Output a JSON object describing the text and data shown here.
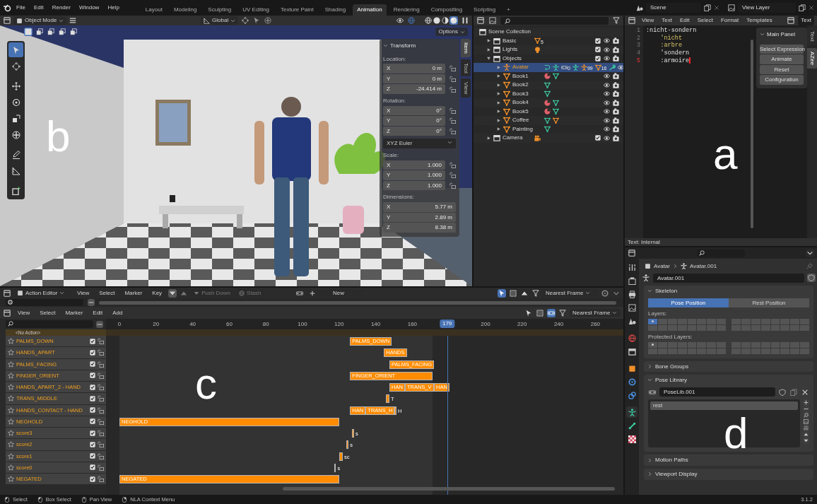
{
  "topbar": {
    "menus": [
      "File",
      "Edit",
      "Render",
      "Window",
      "Help"
    ],
    "workspaces": [
      {
        "label": "Layout",
        "selected": false
      },
      {
        "label": "Modeling",
        "selected": false
      },
      {
        "label": "Sculpting",
        "selected": false
      },
      {
        "label": "UV Editing",
        "selected": false
      },
      {
        "label": "Texture Paint",
        "selected": false
      },
      {
        "label": "Shading",
        "selected": false
      },
      {
        "label": "Animation",
        "selected": true
      },
      {
        "label": "Rendering",
        "selected": false
      },
      {
        "label": "Compositing",
        "selected": false
      },
      {
        "label": "Scripting",
        "selected": false
      }
    ],
    "add_symbol": "+",
    "scene": "Scene",
    "view_layer": "View Layer"
  },
  "viewport": {
    "mode": "Object Mode",
    "orientation": "Global",
    "options": "Options",
    "shading": [
      {
        "kind": "wireframe",
        "selected": false
      },
      {
        "kind": "solid",
        "selected": false
      },
      {
        "kind": "material",
        "selected": false
      },
      {
        "kind": "rendered",
        "selected": true
      }
    ],
    "select_modes": [
      {
        "kind": "set",
        "selected": true
      },
      {
        "kind": "extend",
        "selected": false
      },
      {
        "kind": "subtract",
        "selected": false
      },
      {
        "kind": "invert",
        "selected": false
      },
      {
        "kind": "intersect",
        "selected": false
      }
    ],
    "tools": [
      {
        "kind": "select",
        "selected": true
      },
      {
        "kind": "cursor",
        "selected": false
      },
      {
        "kind": "move",
        "selected": false
      },
      {
        "kind": "rotate",
        "selected": false
      },
      {
        "kind": "scale",
        "selected": false
      },
      {
        "kind": "transform",
        "selected": false
      },
      {
        "kind": "annotate",
        "selected": false
      },
      {
        "kind": "measure",
        "selected": false
      },
      {
        "kind": "add_cube",
        "selected": false
      }
    ],
    "transform": {
      "title": "Transform",
      "sections": [
        {
          "kind": "vector",
          "label": "Location:",
          "fields": [
            {
              "axis": "X",
              "value": "0 m",
              "locked": false
            },
            {
              "axis": "Y",
              "value": "0 m",
              "locked": false
            },
            {
              "axis": "Z",
              "value": "-24.414 m",
              "locked": false
            }
          ]
        },
        {
          "kind": "vector",
          "label": "Rotation:",
          "fields": [
            {
              "axis": "X",
              "value": "0°",
              "locked": false
            },
            {
              "axis": "Y",
              "value": "0°",
              "locked": false
            },
            {
              "axis": "Z",
              "value": "0°",
              "locked": false
            }
          ]
        },
        {
          "kind": "dropdown",
          "value": "XYZ Euler"
        },
        {
          "kind": "vector",
          "label": "Scale:",
          "fields": [
            {
              "axis": "X",
              "value": "1.000",
              "locked": false
            },
            {
              "axis": "Y",
              "value": "1.000",
              "locked": false
            },
            {
              "axis": "Z",
              "value": "1.000",
              "locked": false
            }
          ]
        },
        {
          "kind": "dimensions",
          "label": "Dimensions:",
          "fields": [
            {
              "axis": "X",
              "value": "5.77 m"
            },
            {
              "axis": "Y",
              "value": "2.89 m"
            },
            {
              "axis": "Z",
              "value": "8.38 m"
            }
          ]
        }
      ]
    },
    "side_tabs": [
      {
        "label": "Item",
        "selected": true
      },
      {
        "label": "Tool",
        "selected": false
      },
      {
        "label": "View",
        "selected": false
      }
    ],
    "annotation": "b"
  },
  "outliner": {
    "root": "Scene Collection",
    "items": [
      {
        "label": "Basic",
        "kind": "collection",
        "expanded": false,
        "selected": false,
        "checked": true,
        "icons": [
          {
            "kind": "mesh",
            "badge": "5"
          }
        ]
      },
      {
        "label": "Lights",
        "kind": "collection",
        "expanded": false,
        "selected": false,
        "checked": true,
        "icons": [
          {
            "kind": "light"
          }
        ]
      },
      {
        "label": "Objects",
        "kind": "collection",
        "expanded": true,
        "selected": false,
        "checked": true,
        "children": [
          {
            "label": "Avatar",
            "kind": "armature",
            "expanded": false,
            "selected": true,
            "icons": [
              {
                "kind": "action"
              },
              {
                "kind": "pose"
              },
              {
                "kind": "poselib",
                "badge": "0"
              },
              {
                "kind": "pose"
              },
              {
                "kind": "armature",
                "badge": "99"
              },
              {
                "kind": "mesh",
                "badge": "16"
              },
              {
                "kind": "modifier"
              }
            ]
          },
          {
            "label": "Book1",
            "kind": "mesh",
            "expanded": false,
            "selected": false,
            "icons": [
              {
                "kind": "material"
              },
              {
                "kind": "mesh_data"
              }
            ]
          },
          {
            "label": "Book2",
            "kind": "mesh",
            "expanded": false,
            "selected": false,
            "icons": [
              {
                "kind": "mesh_data"
              }
            ]
          },
          {
            "label": "Book3",
            "kind": "mesh",
            "expanded": false,
            "selected": false,
            "icons": [
              {
                "kind": "mesh_data"
              }
            ]
          },
          {
            "label": "Book4",
            "kind": "mesh",
            "expanded": false,
            "selected": false,
            "icons": [
              {
                "kind": "material"
              },
              {
                "kind": "mesh_data"
              }
            ]
          },
          {
            "label": "Book5",
            "kind": "mesh",
            "expanded": false,
            "selected": false,
            "icons": [
              {
                "kind": "material"
              },
              {
                "kind": "mesh_data"
              }
            ]
          },
          {
            "label": "Coffee",
            "kind": "mesh",
            "expanded": false,
            "selected": false,
            "icons": [
              {
                "kind": "mesh_data"
              },
              {
                "kind": "mesh"
              }
            ]
          },
          {
            "label": "Painting",
            "kind": "mesh",
            "expanded": false,
            "selected": false,
            "icons": [
              {
                "kind": "mesh_data"
              }
            ]
          }
        ]
      },
      {
        "label": "Camera",
        "kind": "collection",
        "expanded": false,
        "selected": false,
        "checked": true,
        "icons": [
          {
            "kind": "camera_object"
          }
        ]
      }
    ]
  },
  "text_editor": {
    "menus": [
      "View",
      "Text",
      "Edit",
      "Select",
      "Format",
      "Templates"
    ],
    "text_name": "Text",
    "lines": [
      {
        "number": "1",
        "code": ":nicht-sondern",
        "kind": "plain",
        "current": false
      },
      {
        "number": "2",
        "code": "    'nicht",
        "kind": "symbol",
        "current": false
      },
      {
        "number": "3",
        "code": "    :arbre",
        "kind": "symbol",
        "current": false
      },
      {
        "number": "4",
        "code": "    'sondern",
        "kind": "plain",
        "current": false
      },
      {
        "number": "5",
        "code": "    :armoire",
        "kind": "plain",
        "current": true
      }
    ],
    "panel": {
      "title": "Main Panel",
      "buttons": [
        "Select Expression",
        "Animate",
        "Reset",
        "Configuration"
      ]
    },
    "side_tabs": [
      {
        "label": "Text",
        "selected": false
      },
      {
        "label": "AZee",
        "selected": true
      }
    ],
    "footer": "Text: Internal",
    "annotation": "a"
  },
  "nla": {
    "action_editor": {
      "mode": "Action Editor",
      "menus": [
        "View",
        "Select",
        "Marker",
        "Key"
      ],
      "push_down": "Push Down",
      "stash": "Stash",
      "new": "New",
      "snap": "Nearest Frame"
    },
    "header": {
      "menus": [
        "View",
        "Select",
        "Marker",
        "Edit",
        "Add"
      ],
      "snap": "Nearest Frame"
    },
    "ticks": [
      "0",
      "20",
      "40",
      "60",
      "80",
      "100",
      "120",
      "140",
      "160",
      "200",
      "220",
      "240",
      "260"
    ],
    "current_frame": "179",
    "action_row": "<No Action>",
    "tracks": [
      {
        "name": "PALMS_DOWN",
        "checked": true,
        "strips": [
          {
            "label": "PALMS_DOWN"
          }
        ]
      },
      {
        "name": "HANDS_APART",
        "checked": true,
        "strips": [
          {
            "label": "HANDS"
          }
        ]
      },
      {
        "name": "PALMS_FACING",
        "checked": true,
        "strips": [
          {
            "label": "PALMS_FACING"
          }
        ]
      },
      {
        "name": "FINGER_ORIENT",
        "checked": true,
        "strips": [
          {
            "label": "FINGER_ORIENT"
          }
        ]
      },
      {
        "name": "HANDS_APART_2 - HAND",
        "checked": true,
        "strips": [
          {
            "label": "HAN"
          },
          {
            "label": "TRANS_V"
          },
          {
            "label": "HAN"
          }
        ]
      },
      {
        "name": "TRANS_MIDDLE",
        "checked": true,
        "strips": [
          {
            "label": "T"
          }
        ]
      },
      {
        "name": "HANDS_CONTACT - HAND",
        "checked": true,
        "strips": [
          {
            "label": "HAN"
          },
          {
            "label": "TRANS_H"
          },
          {
            "label": "H"
          }
        ]
      },
      {
        "name": "NEGHOLD",
        "checked": true,
        "strips": [
          {
            "label": "NEGHOLD"
          }
        ]
      },
      {
        "name": "score3",
        "checked": true,
        "strips": [
          {
            "label": "s"
          }
        ]
      },
      {
        "name": "score2",
        "checked": true,
        "strips": [
          {
            "label": "s"
          }
        ]
      },
      {
        "name": "score1",
        "checked": true,
        "strips": [
          {
            "label": "sc"
          }
        ]
      },
      {
        "name": "score0",
        "checked": true,
        "strips": [
          {
            "label": "s"
          }
        ]
      },
      {
        "name": "NEGATED",
        "checked": true,
        "strips": [
          {
            "label": "NEGATED"
          }
        ]
      }
    ],
    "annotation": "c"
  },
  "properties": {
    "tabs": [
      {
        "kind": "tool",
        "selected": false
      },
      {
        "kind": "render",
        "selected": false
      },
      {
        "kind": "output",
        "selected": false
      },
      {
        "kind": "view_layer",
        "selected": false
      },
      {
        "kind": "scene",
        "selected": false
      },
      {
        "kind": "world",
        "selected": false
      },
      {
        "kind": "collection",
        "selected": false
      },
      {
        "kind": "object",
        "selected": false
      },
      {
        "kind": "physics",
        "selected": false
      },
      {
        "kind": "constraints",
        "selected": false
      },
      {
        "kind": "armature",
        "selected": true
      },
      {
        "kind": "bone",
        "selected": false
      },
      {
        "kind": "texture",
        "selected": false
      }
    ],
    "breadcrumb": [
      "Avatar",
      "Avatar.001"
    ],
    "datablock": "Avatar.001",
    "panels": [
      {
        "kind": "skeleton",
        "title": "Skeleton",
        "expanded": true
      },
      {
        "kind": "plain",
        "title": "Bone Groups",
        "expanded": false
      },
      {
        "kind": "pose_library",
        "title": "Pose Library",
        "expanded": true
      },
      {
        "kind": "plain",
        "title": "Motion Paths",
        "expanded": false
      },
      {
        "kind": "plain",
        "title": "Viewport Display",
        "expanded": false
      }
    ],
    "skeleton": {
      "positions": [
        {
          "label": "Pose Position",
          "selected": true
        },
        {
          "label": "Rest Position",
          "selected": false
        }
      ],
      "layers_label": "Layers:",
      "protected_label": "Protected Layers:",
      "layers": [
        {
          "selected": true,
          "used": true
        },
        {
          "selected": false,
          "used": false
        },
        {
          "selected": false,
          "used": false
        },
        {
          "selected": false,
          "used": false
        },
        {
          "selected": false,
          "used": false
        },
        {
          "selected": false,
          "used": false
        },
        {
          "selected": false,
          "used": false
        },
        {
          "selected": false,
          "used": false
        },
        {
          "selected": false,
          "used": false
        },
        {
          "selected": false,
          "used": false
        },
        {
          "selected": false,
          "used": false
        },
        {
          "selected": false,
          "used": false
        },
        {
          "selected": false,
          "used": false
        },
        {
          "selected": false,
          "used": false
        },
        {
          "selected": false,
          "used": false
        },
        {
          "selected": false,
          "used": false
        },
        {
          "selected": false,
          "used": false
        },
        {
          "selected": false,
          "used": false
        },
        {
          "selected": false,
          "used": false
        },
        {
          "selected": false,
          "used": false
        },
        {
          "selected": false,
          "used": false
        },
        {
          "selected": false,
          "used": false
        },
        {
          "selected": false,
          "used": false
        },
        {
          "selected": false,
          "used": false
        },
        {
          "selected": false,
          "used": false
        },
        {
          "selected": false,
          "used": false
        },
        {
          "selected": false,
          "used": false
        },
        {
          "selected": false,
          "used": false
        },
        {
          "selected": false,
          "used": false
        },
        {
          "selected": false,
          "used": false
        },
        {
          "selected": false,
          "used": false
        },
        {
          "selected": false,
          "used": false
        }
      ],
      "protected": [
        {
          "selected": false,
          "used": true
        },
        {
          "selected": false,
          "used": false
        },
        {
          "selected": false,
          "used": false
        },
        {
          "selected": false,
          "used": false
        },
        {
          "selected": false,
          "used": false
        },
        {
          "selected": false,
          "used": false
        },
        {
          "selected": false,
          "used": false
        },
        {
          "selected": false,
          "used": false
        },
        {
          "selected": false,
          "used": false
        },
        {
          "selected": false,
          "used": false
        },
        {
          "selected": false,
          "used": false
        },
        {
          "selected": false,
          "used": false
        },
        {
          "selected": false,
          "used": false
        },
        {
          "selected": false,
          "used": false
        },
        {
          "selected": false,
          "used": false
        },
        {
          "selected": false,
          "used": false
        },
        {
          "selected": false,
          "used": false
        },
        {
          "selected": false,
          "used": false
        },
        {
          "selected": false,
          "used": false
        },
        {
          "selected": false,
          "used": false
        },
        {
          "selected": false,
          "used": false
        },
        {
          "selected": false,
          "used": false
        },
        {
          "selected": false,
          "used": false
        },
        {
          "selected": false,
          "used": false
        },
        {
          "selected": false,
          "used": false
        },
        {
          "selected": false,
          "used": false
        },
        {
          "selected": false,
          "used": false
        },
        {
          "selected": false,
          "used": false
        },
        {
          "selected": false,
          "used": false
        },
        {
          "selected": false,
          "used": false
        },
        {
          "selected": false,
          "used": false
        },
        {
          "selected": false,
          "used": false
        }
      ]
    },
    "pose_library": {
      "name": "PoseLib.001",
      "poses": [
        {
          "label": "rest",
          "selected": true
        }
      ]
    },
    "annotation": "d"
  },
  "status_bar": {
    "items": [
      {
        "kind": "left",
        "label": "Select"
      },
      {
        "kind": "left",
        "label": "Box Select"
      },
      {
        "kind": "middle",
        "label": "Pan View"
      },
      {
        "kind": "right",
        "label": "NLA Context Menu"
      }
    ],
    "version": "3.1.2"
  }
}
